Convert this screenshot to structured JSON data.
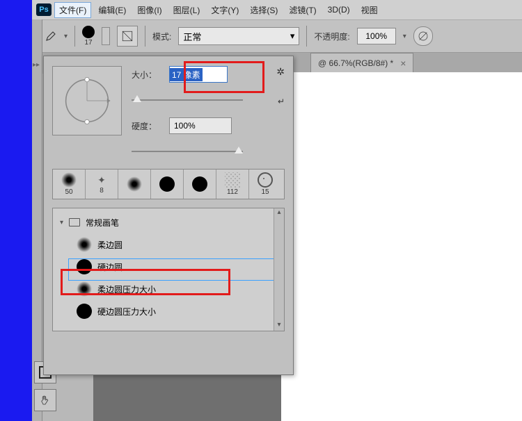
{
  "app_badge": "Ps",
  "menu": {
    "file": "文件(F)",
    "edit": "编辑(E)",
    "image": "图像(I)",
    "layer": "图层(L)",
    "type": "文字(Y)",
    "select": "选择(S)",
    "filter": "滤镜(T)",
    "threeD": "3D(D)",
    "view": "视图"
  },
  "options": {
    "brush_size_label": "17",
    "mode_label": "模式:",
    "mode_value": "正常",
    "opacity_label": "不透明度:",
    "opacity_value": "100%"
  },
  "tab": {
    "title": "@ 66.7%(RGB/8#) *",
    "close": "×"
  },
  "popover": {
    "size_label": "大小：",
    "size_value": "17 像素",
    "hardness_label": "硬度：",
    "hardness_value": "100%",
    "gear": "✲",
    "fold_icon": "↵",
    "swatches": [
      {
        "label": "50"
      },
      {
        "label": "8"
      },
      {
        "label": ""
      },
      {
        "label": ""
      },
      {
        "label": ""
      },
      {
        "label": "112"
      },
      {
        "label": "15"
      }
    ],
    "tree": {
      "folder": "常规画笔",
      "items": [
        "柔边圆",
        "硬边圆",
        "柔边圆压力大小",
        "硬边圆压力大小"
      ]
    }
  }
}
